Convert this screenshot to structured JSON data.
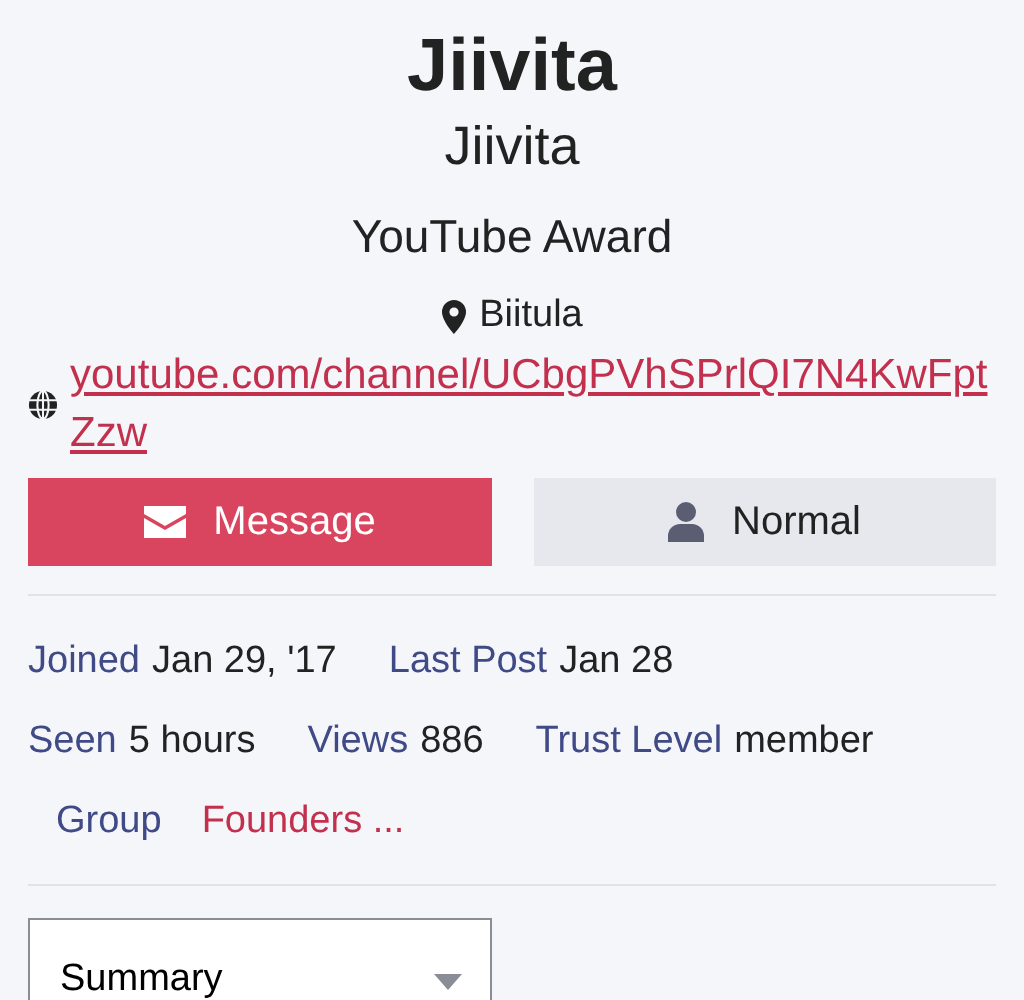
{
  "profile": {
    "username": "Jiivita",
    "name": "Jiivita",
    "title": "YouTube Award",
    "location": "Biitula",
    "website": "youtube.com/channel/UCbgPVhSPrlQI7N4KwFptZzw"
  },
  "actions": [
    {
      "kind": "primary",
      "label": "Message"
    },
    {
      "kind": "secondary",
      "label": "Normal"
    }
  ],
  "stats": [
    [
      {
        "kind": "stat",
        "label": "Joined",
        "value": "Jan 29, '17"
      },
      {
        "kind": "stat",
        "label": "Last Post",
        "value": "Jan 28"
      }
    ],
    [
      {
        "kind": "stat",
        "label": "Seen",
        "value": "5 hours"
      },
      {
        "kind": "stat",
        "label": "Views",
        "value": "886"
      },
      {
        "kind": "stat",
        "label": "Trust Level",
        "value": "member"
      }
    ],
    [
      {
        "kind": "group",
        "label": "Group",
        "value": "Founders ..."
      }
    ]
  ],
  "select": {
    "value": "Summary"
  }
}
